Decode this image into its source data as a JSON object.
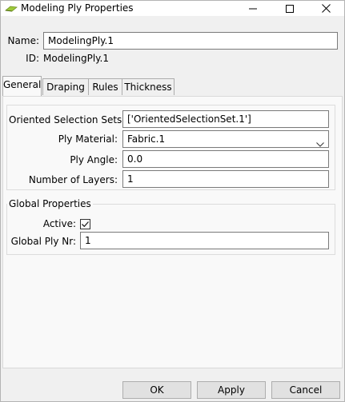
{
  "window": {
    "title": "Modeling Ply Properties",
    "icon": "modeling-ply-app-icon",
    "controls": [
      "minimize-icon",
      "maximize-icon",
      "close-icon"
    ]
  },
  "header": {
    "name_label": "Name:",
    "name_value": "ModelingPly.1",
    "id_label": "ID:",
    "id_value": "ModelingPly.1"
  },
  "tabs": [
    {
      "label": "General",
      "active": true
    },
    {
      "label": "Draping",
      "active": false
    },
    {
      "label": "Rules",
      "active": false
    },
    {
      "label": "Thickness",
      "active": false
    }
  ],
  "general": {
    "oriented_sets_label": "Oriented Selection Sets:",
    "oriented_sets_value": "['OrientedSelectionSet.1']",
    "ply_material_label": "Ply Material:",
    "ply_material_value": "Fabric.1",
    "ply_angle_label": "Ply Angle:",
    "ply_angle_value": "0.0",
    "num_layers_label": "Number of Layers:",
    "num_layers_value": "1"
  },
  "global_properties": {
    "title": "Global Properties",
    "active_label": "Active:",
    "active_checked": true,
    "global_ply_nr_label": "Global Ply Nr:",
    "global_ply_nr_value": "1"
  },
  "buttons": {
    "ok": "OK",
    "apply": "Apply",
    "cancel": "Cancel"
  },
  "colors": {
    "window_bg": "#f0f0f0",
    "panel_bg": "#f9f9f9",
    "field_border": "#7a7a7a",
    "icon_green": "#9dc93a"
  }
}
